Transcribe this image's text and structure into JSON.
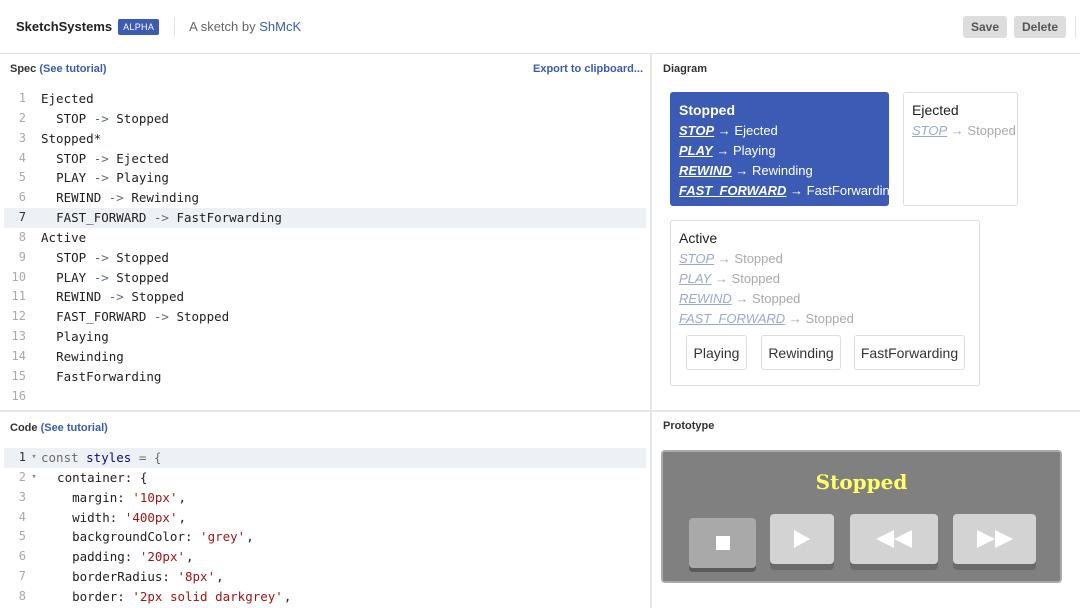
{
  "header": {
    "brand": "SketchSystems",
    "badge": "ALPHA",
    "byline_prefix": "A sketch by",
    "author": "ShMcK",
    "save_label": "Save",
    "delete_label": "Delete"
  },
  "spec_panel": {
    "title": "Spec",
    "tutorial_link": "(See tutorial)",
    "export_link": "Export to clipboard...",
    "active_line": 7,
    "lines": [
      {
        "n": "1",
        "indent": "",
        "name": "Ejected",
        "target": ""
      },
      {
        "n": "2",
        "indent": "  ",
        "name": "STOP",
        "target": "Stopped"
      },
      {
        "n": "3",
        "indent": "",
        "name": "Stopped*",
        "target": ""
      },
      {
        "n": "4",
        "indent": "  ",
        "name": "STOP",
        "target": "Ejected"
      },
      {
        "n": "5",
        "indent": "  ",
        "name": "PLAY",
        "target": "Playing"
      },
      {
        "n": "6",
        "indent": "  ",
        "name": "REWIND",
        "target": "Rewinding"
      },
      {
        "n": "7",
        "indent": "  ",
        "name": "FAST_FORWARD",
        "target": "FastForwarding"
      },
      {
        "n": "8",
        "indent": "",
        "name": "Active",
        "target": ""
      },
      {
        "n": "9",
        "indent": "  ",
        "name": "STOP",
        "target": "Stopped"
      },
      {
        "n": "10",
        "indent": "  ",
        "name": "PLAY",
        "target": "Stopped"
      },
      {
        "n": "11",
        "indent": "  ",
        "name": "REWIND",
        "target": "Stopped"
      },
      {
        "n": "12",
        "indent": "  ",
        "name": "FAST_FORWARD",
        "target": "Stopped"
      },
      {
        "n": "13",
        "indent": "  ",
        "name": "Playing",
        "target": ""
      },
      {
        "n": "14",
        "indent": "  ",
        "name": "Rewinding",
        "target": ""
      },
      {
        "n": "15",
        "indent": "  ",
        "name": "FastForwarding",
        "target": ""
      },
      {
        "n": "16",
        "indent": "",
        "name": "",
        "target": ""
      }
    ],
    "arrow": "->"
  },
  "code_panel": {
    "title": "Code",
    "tutorial_link": "(See tutorial)",
    "lines": [
      {
        "n": "1",
        "fold": "▾",
        "parts": [
          [
            "kw",
            "const "
          ],
          [
            "prop",
            "styles"
          ],
          [
            "kw",
            " = {"
          ]
        ]
      },
      {
        "n": "2",
        "fold": "▾",
        "parts": [
          [
            "txt",
            "  container: {"
          ]
        ]
      },
      {
        "n": "3",
        "fold": "",
        "parts": [
          [
            "txt",
            "    margin: "
          ],
          [
            "str",
            "'10px'"
          ],
          [
            "txt",
            ","
          ]
        ]
      },
      {
        "n": "4",
        "fold": "",
        "parts": [
          [
            "txt",
            "    width: "
          ],
          [
            "str",
            "'400px'"
          ],
          [
            "txt",
            ","
          ]
        ]
      },
      {
        "n": "5",
        "fold": "",
        "parts": [
          [
            "txt",
            "    backgroundColor: "
          ],
          [
            "str",
            "'grey'"
          ],
          [
            "txt",
            ","
          ]
        ]
      },
      {
        "n": "6",
        "fold": "",
        "parts": [
          [
            "txt",
            "    padding: "
          ],
          [
            "str",
            "'20px'"
          ],
          [
            "txt",
            ","
          ]
        ]
      },
      {
        "n": "7",
        "fold": "",
        "parts": [
          [
            "txt",
            "    borderRadius: "
          ],
          [
            "str",
            "'8px'"
          ],
          [
            "txt",
            ","
          ]
        ]
      },
      {
        "n": "8",
        "fold": "",
        "parts": [
          [
            "txt",
            "    border: "
          ],
          [
            "str",
            "'2px solid darkgrey'"
          ],
          [
            "txt",
            ","
          ]
        ]
      }
    ]
  },
  "diagram": {
    "title": "Diagram",
    "arrow": "→",
    "stopped": {
      "name": "Stopped",
      "transitions": [
        {
          "event": "STOP",
          "target": "Ejected"
        },
        {
          "event": "PLAY",
          "target": "Playing"
        },
        {
          "event": "REWIND",
          "target": "Rewinding"
        },
        {
          "event": "FAST_FORWARD",
          "target": "FastForwarding"
        }
      ]
    },
    "ejected": {
      "name": "Ejected",
      "transitions": [
        {
          "event": "STOP",
          "target": "Stopped"
        }
      ]
    },
    "active": {
      "name": "Active",
      "transitions": [
        {
          "event": "STOP",
          "target": "Stopped"
        },
        {
          "event": "PLAY",
          "target": "Stopped"
        },
        {
          "event": "REWIND",
          "target": "Stopped"
        },
        {
          "event": "FAST_FORWARD",
          "target": "Stopped"
        }
      ],
      "children": [
        "Playing",
        "Rewinding",
        "FastForwarding"
      ]
    }
  },
  "prototype": {
    "title": "Prototype",
    "state_text": "Stopped",
    "buttons": [
      "stop-icon",
      "play-icon",
      "rewind-icon",
      "fast-forward-icon"
    ]
  },
  "colors": {
    "accent": "#3b5bb5",
    "prototype_bg": "#808080",
    "prototype_text": "#ffff66"
  }
}
